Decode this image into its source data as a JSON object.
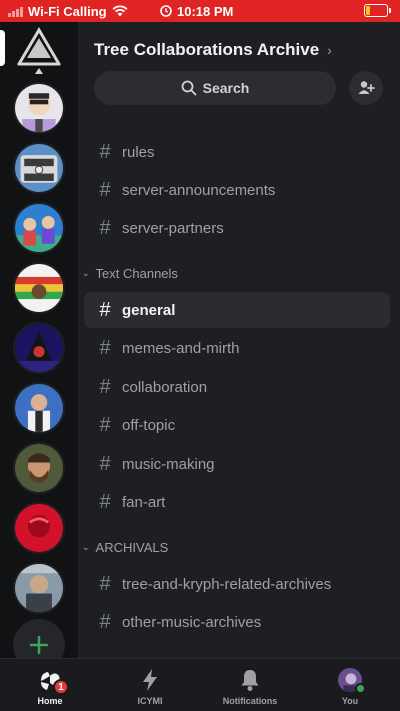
{
  "status_bar": {
    "carrier": "Wi-Fi Calling",
    "time": "10:18 PM",
    "battery_level": 0.2,
    "icons": [
      "signal-bars-icon",
      "wifi-icon",
      "alarm-icon",
      "battery-icon"
    ]
  },
  "server": {
    "name": "Tree Collaborations Archive",
    "search_placeholder": "Search"
  },
  "channels_top": [
    {
      "name": "rules"
    },
    {
      "name": "server-announcements"
    },
    {
      "name": "server-partners"
    }
  ],
  "categories": [
    {
      "label": "Text Channels",
      "channels": [
        {
          "name": "general",
          "active": true
        },
        {
          "name": "memes-and-mirth"
        },
        {
          "name": "collaboration"
        },
        {
          "name": "off-topic"
        },
        {
          "name": "music-making"
        },
        {
          "name": "fan-art"
        }
      ]
    },
    {
      "label": "ARCHIVALS",
      "channels": [
        {
          "name": "tree-and-kryph-related-archives"
        },
        {
          "name": "other-music-archives"
        }
      ]
    }
  ],
  "nav": {
    "home": "Home",
    "home_badge": "1",
    "icymi": "ICYMI",
    "notifications": "Notifications",
    "you": "You"
  },
  "colors": {
    "status_bar": "#e02424",
    "accent_green": "#3ba55c",
    "badge_red": "#e23b3b"
  }
}
